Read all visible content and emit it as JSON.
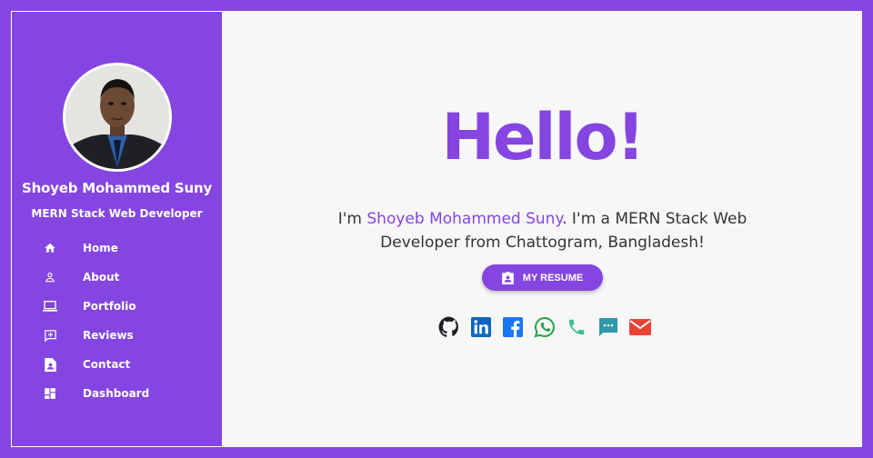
{
  "profile": {
    "name": "Shoyeb Mohammed Suny",
    "role": "MERN Stack Web Developer"
  },
  "nav": [
    {
      "label": "Home",
      "icon": "home-icon"
    },
    {
      "label": "About",
      "icon": "person-icon"
    },
    {
      "label": "Portfolio",
      "icon": "laptop-icon"
    },
    {
      "label": "Reviews",
      "icon": "add-review-icon"
    },
    {
      "label": "Contact",
      "icon": "contact-file-icon"
    },
    {
      "label": "Dashboard",
      "icon": "dashboard-icon"
    }
  ],
  "hero": {
    "greeting": "Hello!",
    "intro_prefix": "I'm ",
    "intro_name": "Shoyeb Mohammed Suny",
    "intro_suffix": ". I'm a MERN Stack Web Developer from Chattogram, Bangladesh!",
    "resume_label": "MY RESUME"
  },
  "socials": [
    {
      "icon": "github-icon"
    },
    {
      "icon": "linkedin-icon"
    },
    {
      "icon": "facebook-icon"
    },
    {
      "icon": "whatsapp-icon"
    },
    {
      "icon": "phone-icon"
    },
    {
      "icon": "sms-icon"
    },
    {
      "icon": "email-icon"
    }
  ],
  "colors": {
    "accent": "#8445e0",
    "background": "#f7f7f7",
    "text": "#333333"
  }
}
